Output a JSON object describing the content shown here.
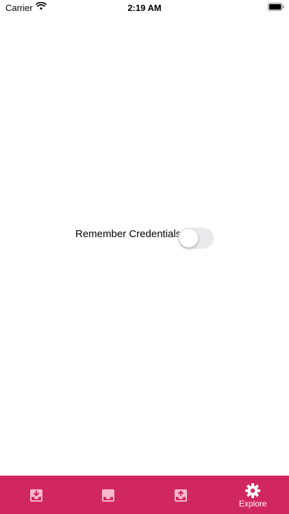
{
  "status_bar": {
    "carrier": "Carrier",
    "time": "2:19 AM",
    "wifi_icon": "wifi-icon",
    "battery_icon": "battery-icon"
  },
  "settings": {
    "remember_credentials_label": "Remember Credentials",
    "remember_credentials_enabled": false
  },
  "tab_bar": {
    "background_color": "#d1275f",
    "tabs": [
      {
        "icon": "tray-download-icon",
        "label": "",
        "selected": false
      },
      {
        "icon": "inbox-icon",
        "label": "",
        "selected": false
      },
      {
        "icon": "tray-upload-icon",
        "label": "",
        "selected": false
      },
      {
        "icon": "gear-icon",
        "label": "Explore",
        "selected": true
      }
    ]
  }
}
